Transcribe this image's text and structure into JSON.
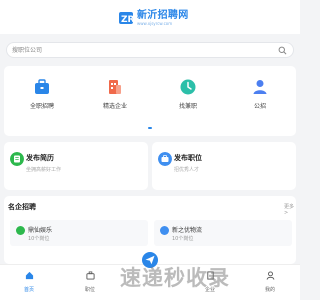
{
  "header": {
    "logo_name": "新沂招聘网",
    "logo_url": "www.xjsyrcw.com"
  },
  "search": {
    "placeholder": "搜职位公司"
  },
  "quick_nav": [
    {
      "label": "全职招聘",
      "icon": "briefcase-icon",
      "color": "#2a86e8"
    },
    {
      "label": "精选企业",
      "icon": "building-icon",
      "color": "#f0694a"
    },
    {
      "label": "找兼职",
      "icon": "clock-icon",
      "color": "#2cbfa9"
    },
    {
      "label": "公招",
      "icon": "person-icon",
      "color": "#4c7ff0"
    }
  ],
  "post_cards": [
    {
      "title": "发布简历",
      "subtitle": "坐拥高薪好工作",
      "icon": "resume-icon",
      "color": "#2db84d"
    },
    {
      "title": "发布职位",
      "subtitle": "招优秀人才",
      "icon": "post-job-icon",
      "color": "#3f8ff0"
    }
  ],
  "famous": {
    "title": "名企招聘",
    "more": "更多 >",
    "companies": [
      {
        "name": "鼎仙娱乐",
        "count": "10个岗位",
        "color": "#2db84d"
      },
      {
        "name": "新之优物流",
        "count": "10个岗位",
        "color": "#3f8ff0"
      }
    ]
  },
  "tabbar": {
    "items": [
      {
        "label": "首页",
        "icon": "home-icon",
        "active": true
      },
      {
        "label": "职位",
        "icon": "job-icon",
        "active": false
      },
      {
        "label": "企业",
        "icon": "company-icon",
        "active": false
      },
      {
        "label": "我的",
        "icon": "user-icon",
        "active": false
      }
    ]
  },
  "watermark": "速递秒收录",
  "colors": {
    "accent": "#2a86e8",
    "background": "#f3f4f6"
  }
}
